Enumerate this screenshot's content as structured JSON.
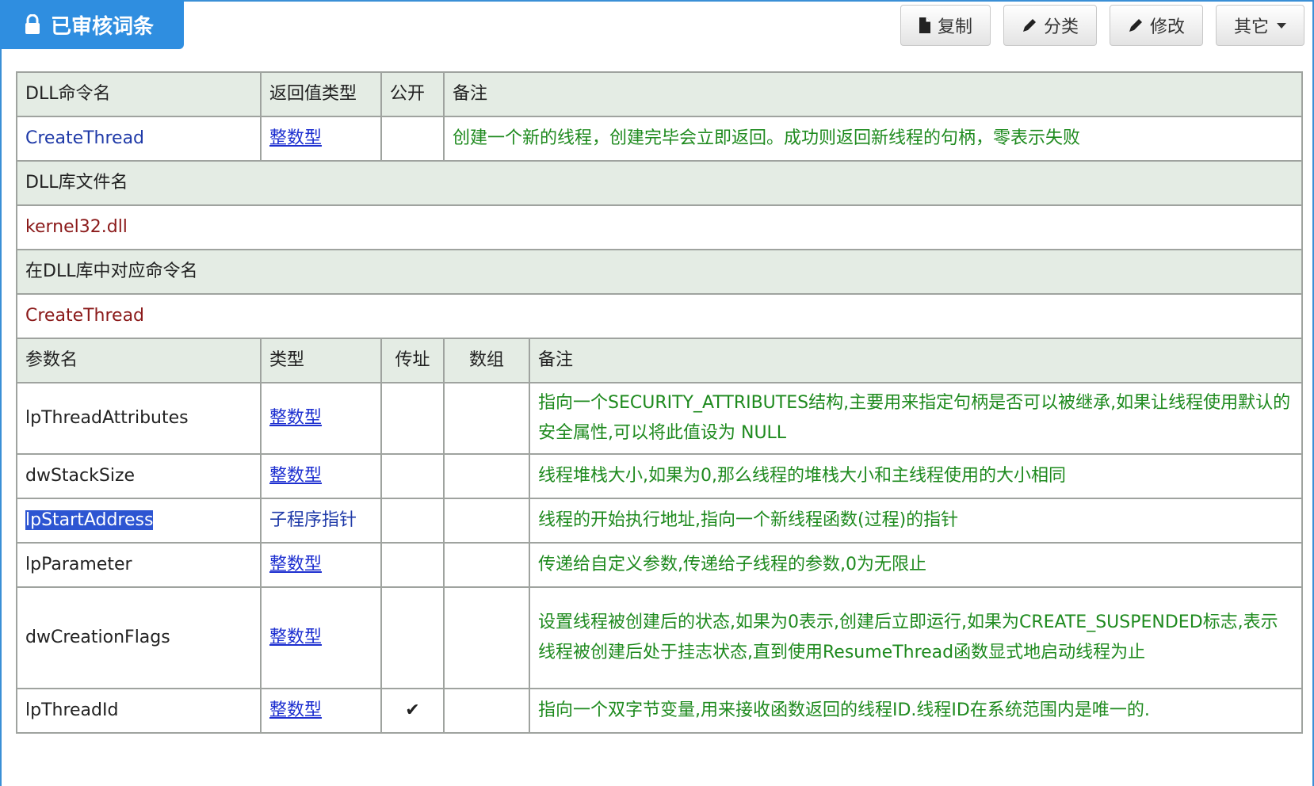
{
  "window": {
    "title": "已审核词条"
  },
  "toolbar": {
    "copy_label": "复制",
    "classify_label": "分类",
    "edit_label": "修改",
    "other_label": "其它"
  },
  "dll": {
    "header": {
      "name": "DLL命令名",
      "return_type": "返回值类型",
      "public": "公开",
      "note": "备注"
    },
    "name": "CreateThread",
    "return_type": "整数型",
    "public": "",
    "note": "创建一个新的线程，创建完毕会立即返回。成功则返回新线程的句柄，零表示失败"
  },
  "lib": {
    "label": "DLL库文件名",
    "value": "kernel32.dll"
  },
  "entry": {
    "label": "在DLL库中对应命令名",
    "value": "CreateThread"
  },
  "params": {
    "header": {
      "name": "参数名",
      "type": "类型",
      "byref": "传址",
      "array": "数组",
      "note": "备注"
    },
    "rows": [
      {
        "name": "lpThreadAttributes",
        "type": "整数型",
        "byref": "",
        "array": "",
        "note": "指向一个SECURITY_ATTRIBUTES结构,主要用来指定句柄是否可以被继承,如果让线程使用默认的安全属性,可以将此值设为 NULL"
      },
      {
        "name": "dwStackSize",
        "type": "整数型",
        "byref": "",
        "array": "",
        "note": "线程堆栈大小,如果为0,那么线程的堆栈大小和主线程使用的大小相同"
      },
      {
        "name": "lpStartAddress",
        "type": "子程序指针",
        "byref": "",
        "array": "",
        "note": "线程的开始执行地址,指向一个新线程函数(过程)的指针"
      },
      {
        "name": "lpParameter",
        "type": "整数型",
        "byref": "",
        "array": "",
        "note": "传递给自定义参数,传递给子线程的参数,0为无限止"
      },
      {
        "name": "dwCreationFlags",
        "type": "整数型",
        "byref": "",
        "array": "",
        "note": "设置线程被创建后的状态,如果为0表示,创建后立即运行,如果为CREATE_SUSPENDED标志,表示线程被创建后处于挂志状态,直到使用ResumeThread函数显式地启动线程为止"
      },
      {
        "name": "lpThreadId",
        "type": "整数型",
        "byref": "✔",
        "array": "",
        "note": "指向一个双字节变量,用来接收函数返回的线程ID.线程ID在系统范围内是唯一的."
      }
    ]
  }
}
